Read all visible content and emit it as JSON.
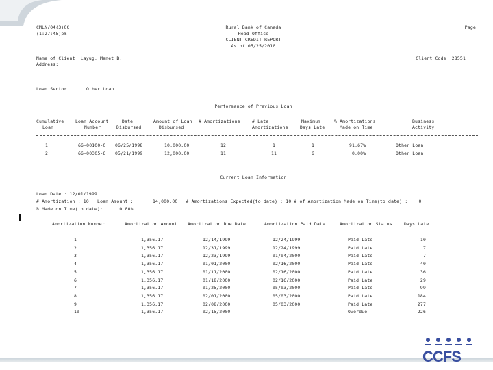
{
  "header": {
    "left_line1": "CMLN/04(3)0C",
    "left_line2": "(1:27:45)pm",
    "bank_name": "Rural Bank of Canada",
    "office": "Head Office",
    "report_title": "CLIENT CREDIT REPORT",
    "as_of": "As of 05/25/2010",
    "page_label": "Page"
  },
  "client": {
    "name_line": "Name of Client  Layug, Manet B.",
    "address_label": "Address:",
    "client_code_line": "Client Code  28551",
    "loan_sector_label": "Loan Sector",
    "loan_sector_value": "Other Loan"
  },
  "previous": {
    "section_title": "Performance of Previous Loan",
    "headers_row1": [
      "Cumulative",
      "Loan Account",
      "Date",
      "Amount of Loan",
      "# Amortizations",
      "# Late",
      "Maximum",
      "% Amortizations",
      "Business"
    ],
    "headers_row2": [
      "Loan",
      "Number",
      "Disbursed",
      "Disbursed",
      "",
      "Amortizations",
      "Days Late",
      "Made on Time",
      "Activity"
    ],
    "rows": [
      [
        "1",
        "66-00100-0",
        "06/25/1998",
        "10,000.00",
        "12",
        "1",
        "1",
        "91.67%",
        "Other Loan"
      ],
      [
        "2",
        "66-00305-6",
        "05/21/1999",
        "12,000.00",
        "11",
        "11",
        "6",
        "0.00%",
        "Other Loan"
      ]
    ]
  },
  "current": {
    "section_title": "Current Loan Information",
    "loan_date_line": "Loan Date : 12/01/1999",
    "summary_line": "# Amortization : 10   Loan Amount :       14,000.00   # Amortizations Expected(to date) : 10 # of Amortization Made on Time(to date) :    0",
    "percent_line": "% Made on Time(to date):      0.00%",
    "table_headers": [
      "Amortization Number",
      "Amortization Amount",
      "Amortization Due Date",
      "Amortization Paid Date",
      "Amortization Status",
      "Days Late"
    ],
    "rows": [
      [
        "1",
        "1,356.17",
        "12/14/1999",
        "12/24/1999",
        "Paid Late",
        "10"
      ],
      [
        "2",
        "1,356.17",
        "12/31/1999",
        "12/24/1999",
        "Paid Late",
        "7"
      ],
      [
        "3",
        "1,356.17",
        "12/23/1999",
        "01/04/2000",
        "Paid Late",
        "7"
      ],
      [
        "4",
        "1,356.17",
        "01/01/2000",
        "02/16/2000",
        "Paid Late",
        "40"
      ],
      [
        "5",
        "1,356.17",
        "01/11/2000",
        "02/16/2000",
        "Paid Late",
        "36"
      ],
      [
        "6",
        "1,356.17",
        "01/18/2000",
        "02/16/2000",
        "Paid Late",
        "29"
      ],
      [
        "7",
        "1,356.17",
        "01/25/2000",
        "05/03/2000",
        "Paid Late",
        "99"
      ],
      [
        "8",
        "1,356.17",
        "02/01/2000",
        "05/03/2000",
        "Paid Late",
        "184"
      ],
      [
        "9",
        "1,356.17",
        "02/08/2000",
        "05/03/2000",
        "Paid Late",
        "277"
      ],
      [
        "10",
        "1,356.17",
        "02/15/2000",
        "",
        "Overdue",
        "226"
      ]
    ]
  },
  "logo": {
    "text": "CCFS",
    "color": "#3a4fa0"
  }
}
